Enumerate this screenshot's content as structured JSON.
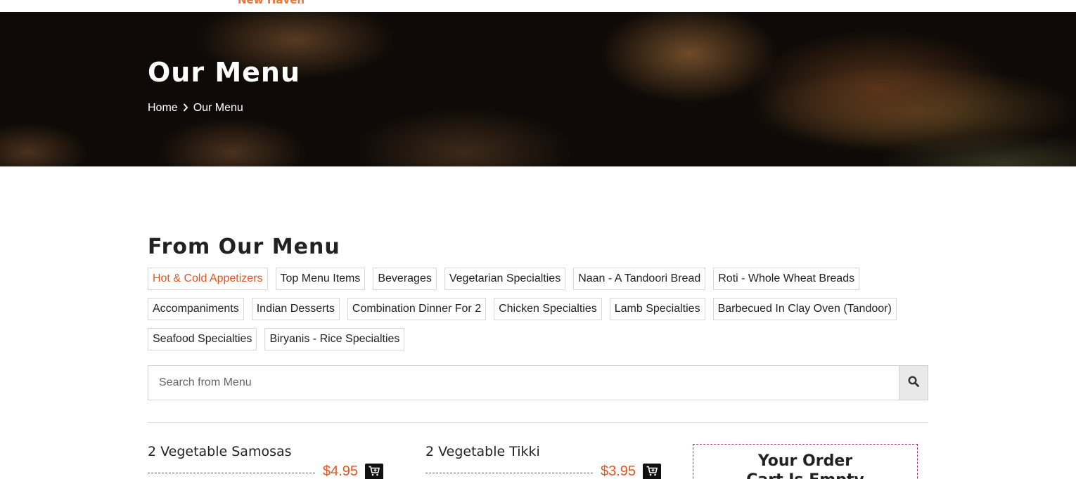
{
  "header": {
    "brand_sub": "New Haven"
  },
  "hero": {
    "title": "Our Menu",
    "breadcrumb": {
      "home": "Home",
      "separator_icon": "chevron-right-icon",
      "current": "Our Menu"
    }
  },
  "menu_section": {
    "title": "From Our Menu",
    "categories": [
      {
        "label": "Hot & Cold Appetizers",
        "active": true
      },
      {
        "label": "Top Menu Items"
      },
      {
        "label": "Beverages"
      },
      {
        "label": "Vegetarian Specialties"
      },
      {
        "label": "Naan - A Tandoori Bread"
      },
      {
        "label": "Roti - Whole Wheat Breads"
      },
      {
        "label": "Accompaniments"
      },
      {
        "label": "Indian Desserts"
      },
      {
        "label": "Combination Dinner For 2"
      },
      {
        "label": "Chicken Specialties"
      },
      {
        "label": "Lamb Specialties"
      },
      {
        "label": "Barbecued In Clay Oven (Tandoor)"
      },
      {
        "label": "Seafood Specialties"
      },
      {
        "label": "Biryanis - Rice Specialties"
      }
    ],
    "search": {
      "placeholder": "Search from Menu",
      "value": "",
      "icon": "search-icon"
    },
    "items": [
      {
        "name": "2 Vegetable Samosas",
        "price": "$4.95",
        "icon": "cart-plus-icon"
      },
      {
        "name": "2 Vegetable Tikki",
        "price": "$3.95",
        "icon": "cart-plus-icon"
      }
    ]
  },
  "order": {
    "title": "Your Order",
    "empty_text": "Cart Is Empty"
  },
  "colors": {
    "accent": "#e8531e",
    "brand_orange": "#e8783c",
    "order_border": "#9b2c7a"
  }
}
